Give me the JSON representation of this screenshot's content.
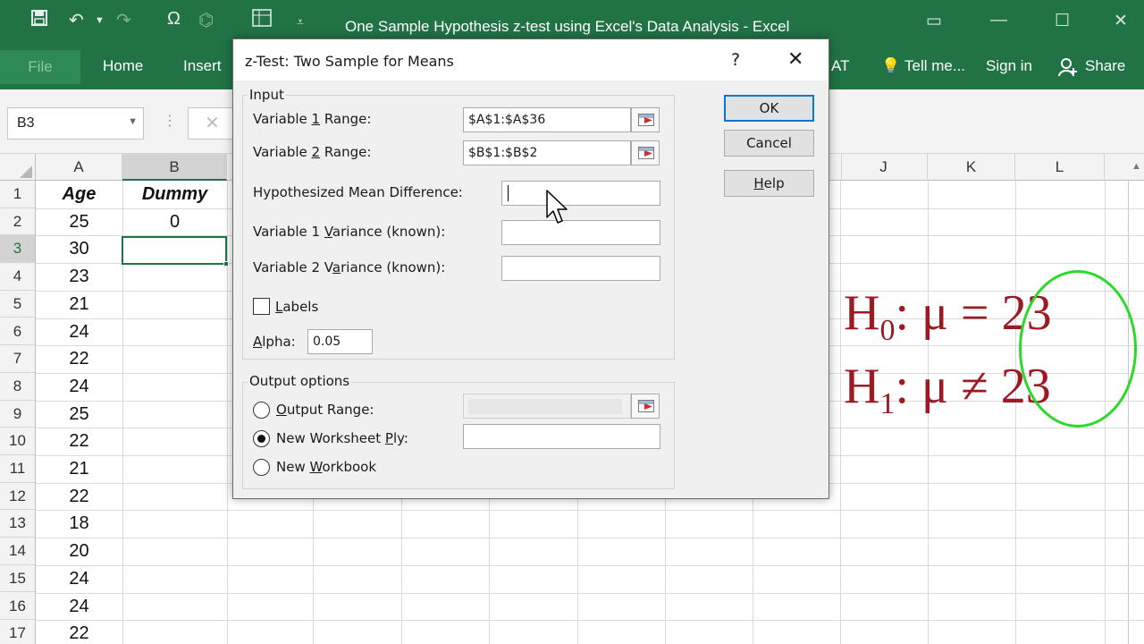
{
  "window": {
    "title": "One Sample Hypothesis z-test using Excel's Data Analysis - Excel",
    "quick_access": [
      "save-icon",
      "undo-icon",
      "redo-icon",
      "omega-icon",
      "touch-mode-icon",
      "form-icon",
      "customize-icon"
    ]
  },
  "ribbon": {
    "tabs": [
      "File",
      "Home",
      "Insert",
      "AT",
      "Tell me...",
      "Sign in",
      "Share"
    ]
  },
  "formula_bar": {
    "name_box": "B3",
    "cancel_symbol": "✕"
  },
  "sheet": {
    "columns": [
      "A",
      "B",
      "J",
      "K",
      "L"
    ],
    "rows": [
      "1",
      "2",
      "3",
      "4",
      "5",
      "6",
      "7",
      "8",
      "9",
      "10",
      "11",
      "12",
      "13",
      "14",
      "15",
      "16",
      "17"
    ],
    "col_a": [
      "Age",
      "25",
      "30",
      "23",
      "21",
      "24",
      "22",
      "24",
      "25",
      "22",
      "21",
      "22",
      "18",
      "20",
      "24",
      "24",
      "22"
    ],
    "col_b": [
      "Dummy",
      "0"
    ]
  },
  "hypothesis": {
    "h0_label": "H",
    "h0_sub": "0",
    "h0_rest": ": μ = 23",
    "h1_label": "H",
    "h1_sub": "1",
    "h1_rest": ": μ ≠ 23",
    "ink_color": "#9c1a24",
    "circle_color": "#2bd92b"
  },
  "dialog": {
    "title": "z-Test: Two Sample for Means",
    "help_symbol": "?",
    "close_symbol": "✕",
    "input_group": "Input",
    "var1_range_label": "Variable 1 Range:",
    "var1_range_value": "$A$1:$A$36",
    "var2_range_label": "Variable 2 Range:",
    "var2_range_value": "$B$1:$B$2",
    "hyp_mean_diff_label": "Hypothesized Mean Difference:",
    "hyp_mean_diff_value": "",
    "var1_variance_label": "Variable 1 Variance (known):",
    "var1_variance_value": "",
    "var2_variance_label": "Variable 2 Variance (known):",
    "var2_variance_value": "",
    "labels_checkbox": "Labels",
    "labels_checked": false,
    "alpha_label": "Alpha:",
    "alpha_value": "0.05",
    "output_group": "Output options",
    "output_range_label": "Output Range:",
    "new_ply_label": "New Worksheet Ply:",
    "new_workbook_label": "New Workbook",
    "selected_output": "New Worksheet Ply:",
    "ok_label": "OK",
    "cancel_label": "Cancel",
    "help_label": "Help"
  },
  "colors": {
    "excel_green": "#217346",
    "default_button_border": "#0a74d1"
  }
}
